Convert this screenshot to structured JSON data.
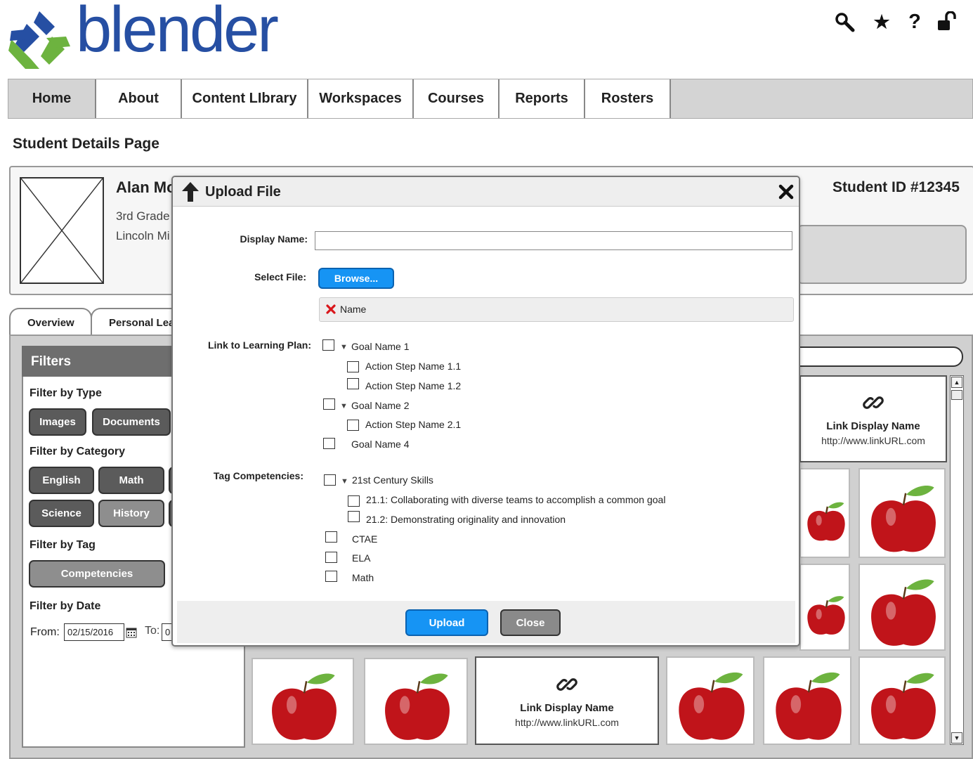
{
  "header": {
    "logo_text": "blender",
    "icons": [
      "search-icon",
      "star-icon",
      "help-icon",
      "unlock-icon"
    ]
  },
  "nav": {
    "items": [
      {
        "label": "Home"
      },
      {
        "label": "About"
      },
      {
        "label": "Content LIbrary"
      },
      {
        "label": "Workspaces"
      },
      {
        "label": "Courses"
      },
      {
        "label": "Reports"
      },
      {
        "label": "Rosters"
      }
    ]
  },
  "page": {
    "title": "Student Details Page"
  },
  "student": {
    "name": "Alan Mc",
    "grade": "3rd Grade",
    "school": "Lincoln Mi",
    "id_label": "Student ID #12345"
  },
  "tabs": [
    {
      "label": "Overview"
    },
    {
      "label": "Personal Lea"
    }
  ],
  "filters": {
    "heading": "Filters",
    "by_type": {
      "label": "Filter by Type",
      "options": [
        "Images",
        "Documents"
      ]
    },
    "by_category": {
      "label": "Filter by Category",
      "options": [
        "English",
        "Math",
        "Science",
        "History"
      ]
    },
    "by_tag": {
      "label": "Filter by Tag",
      "options": [
        "Competencies"
      ]
    },
    "by_date": {
      "label": "Filter by Date",
      "from_label": "From:",
      "from_value": "02/15/2016",
      "to_label": "To:",
      "to_value": "0"
    }
  },
  "content_grid": {
    "link_name": "Link Display Name",
    "link_url": "http://www.linkURL.com"
  },
  "modal": {
    "title": "Upload File",
    "display_name_label": "Display Name:",
    "display_name_value": "",
    "select_file_label": "Select File:",
    "browse_label": "Browse...",
    "selected_file_name": "Name",
    "link_label": "Link to Learning Plan:",
    "goals": [
      {
        "label": "Goal Name 1",
        "steps": [
          "Action Step Name 1.1",
          "Action Step Name 1.2"
        ]
      },
      {
        "label": "Goal Name 2",
        "steps": [
          "Action Step Name 2.1"
        ]
      },
      {
        "label": "Goal Name 4",
        "steps": []
      }
    ],
    "tag_label": "Tag Competencies:",
    "competencies": {
      "group": "21st Century Skills",
      "items": [
        "21.1: Collaborating with diverse teams to accomplish a common goal",
        "21.2: Demonstrating originality and innovation"
      ],
      "others": [
        "CTAE",
        "ELA",
        "Math"
      ]
    },
    "upload_label": "Upload",
    "close_label": "Close"
  },
  "colors": {
    "brand_blue": "#264fa3",
    "brand_green": "#6db33f",
    "button_blue": "#1694f4",
    "apple_red": "#c0141a"
  }
}
